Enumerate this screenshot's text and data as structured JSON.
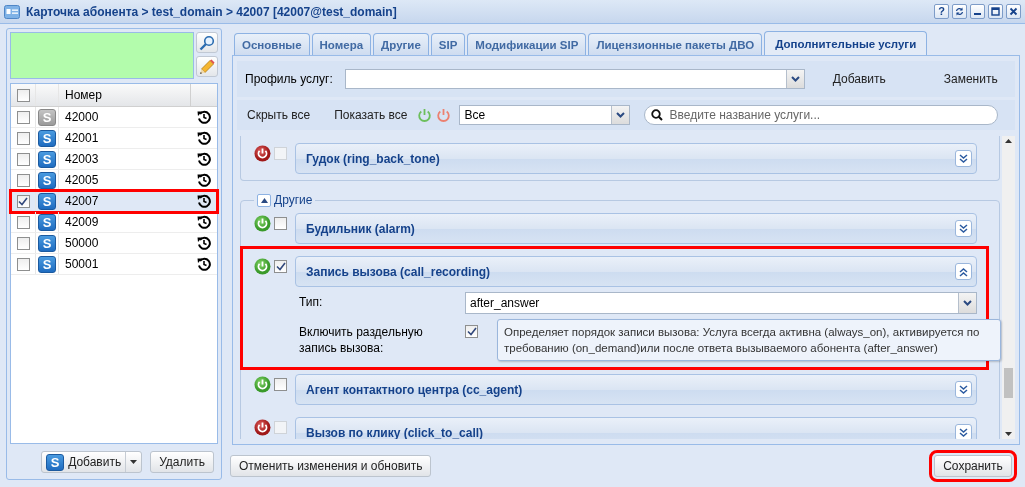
{
  "window": {
    "title": "Карточка абонента > test_domain > 42007 [42007@test_domain]",
    "help_button": "?"
  },
  "subscribers": {
    "header_checked": false,
    "columns": [
      "Номер"
    ],
    "rows": [
      {
        "badge": "S",
        "enabled": false,
        "number": "42000",
        "checked": false,
        "selected": false,
        "highlighted": false
      },
      {
        "badge": "S",
        "enabled": true,
        "number": "42001",
        "checked": false,
        "selected": false,
        "highlighted": false
      },
      {
        "badge": "S",
        "enabled": true,
        "number": "42003",
        "checked": false,
        "selected": false,
        "highlighted": false
      },
      {
        "badge": "S",
        "enabled": true,
        "number": "42005",
        "checked": false,
        "selected": false,
        "highlighted": false
      },
      {
        "badge": "S",
        "enabled": true,
        "number": "42007",
        "checked": true,
        "selected": true,
        "highlighted": true
      },
      {
        "badge": "S",
        "enabled": true,
        "number": "42009",
        "checked": false,
        "selected": false,
        "highlighted": false
      },
      {
        "badge": "S",
        "enabled": true,
        "number": "50000",
        "checked": false,
        "selected": false,
        "highlighted": false
      },
      {
        "badge": "S",
        "enabled": true,
        "number": "50001",
        "checked": false,
        "selected": false,
        "highlighted": false
      }
    ]
  },
  "left_buttons": {
    "add": {
      "badge": "S",
      "label": "Добавить"
    },
    "delete": "Удалить"
  },
  "tabs": [
    {
      "label": "Основные",
      "selected": false
    },
    {
      "label": "Номера",
      "selected": false
    },
    {
      "label": "Другие",
      "selected": false
    },
    {
      "label": "SIP",
      "selected": false
    },
    {
      "label": "Модификации SIP",
      "selected": false
    },
    {
      "label": "Лицензионные пакеты ДВО",
      "selected": false
    },
    {
      "label": "Дополнительные услуги",
      "selected": true
    }
  ],
  "profile": {
    "label": "Профиль услуг:",
    "add": "Добавить",
    "replace": "Заменить"
  },
  "toolbar": {
    "hide_all": "Скрыть все",
    "show_all": "Показать все",
    "filter": "Все",
    "search_placeholder": "Введите название услуги..."
  },
  "groups": [
    {
      "services": [
        {
          "name": "Гудок (ring_back_tone)",
          "active": false,
          "checked": false,
          "disabled": true,
          "expanded": false,
          "highlighted": false
        }
      ]
    },
    {
      "label": "Другие",
      "expanded": true,
      "services": [
        {
          "name": "Будильник (alarm)",
          "active": true,
          "checked": false,
          "disabled": false,
          "expanded": false,
          "highlighted": false
        },
        {
          "name": "Запись вызова (call_recording)",
          "active": true,
          "checked": true,
          "disabled": false,
          "expanded": true,
          "highlighted": true,
          "fields": [
            {
              "kind": "select",
              "label": "Тип:",
              "value": "after_answer"
            },
            {
              "kind": "checkbox",
              "label": "Включить раздельную запись вызова:",
              "checked": true,
              "hint": "Определяет порядок записи вызова: Услуга всегда активна (always_on), активируется по требованию (on_demand)или после ответа вызываемого абонента (after_answer)"
            }
          ]
        },
        {
          "name": "Агент контактного центра (cc_agent)",
          "active": true,
          "checked": false,
          "disabled": false,
          "expanded": false,
          "highlighted": false
        },
        {
          "name": "Вызов по клику (click_to_call)",
          "active": false,
          "checked": false,
          "disabled": true,
          "expanded": false,
          "highlighted": false
        }
      ]
    }
  ],
  "buttons": {
    "revert": "Отменить изменения и обновить",
    "save": {
      "label": "Сохранить",
      "highlighted": true
    }
  }
}
